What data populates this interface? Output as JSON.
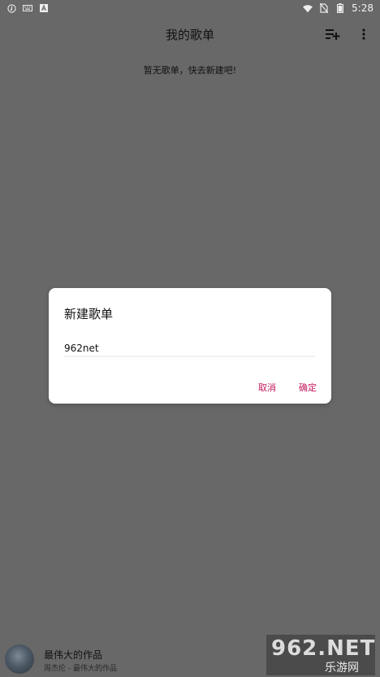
{
  "status_bar": {
    "time": "5:28",
    "left_icons": [
      "music-note-icon",
      "keyboard-icon",
      "text-a-icon"
    ],
    "right_icons": [
      "wifi-icon",
      "no-sim-icon",
      "battery-icon"
    ]
  },
  "app_bar": {
    "title": "我的歌单",
    "actions": [
      "playlist-add-icon",
      "more-vert-icon"
    ]
  },
  "main": {
    "empty_text": "暂无歌单，快去新建吧!"
  },
  "dialog": {
    "title": "新建歌单",
    "input_value": "962net",
    "cancel_label": "取消",
    "ok_label": "确定"
  },
  "player": {
    "title": "最伟大的作品",
    "subtitle": "周杰伦 - 最伟大的作品"
  },
  "watermark": {
    "brand": "962.NET",
    "caption": "乐游网"
  },
  "colors": {
    "accent": "#c2185b",
    "overlay": "#686868"
  }
}
